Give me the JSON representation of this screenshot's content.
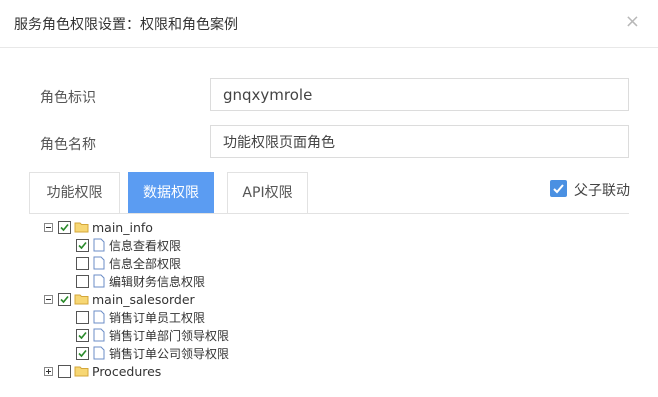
{
  "dialog": {
    "title": "服务角色权限设置：权限和角色案例",
    "close_glyph": "×"
  },
  "form": {
    "role_id_label": "角色标识",
    "role_id_value": "gnqxymrole",
    "role_name_label": "角色名称",
    "role_name_value": "功能权限页面角色"
  },
  "tabs": [
    {
      "label": "功能权限",
      "active": false
    },
    {
      "label": "数据权限",
      "active": true
    },
    {
      "label": "API权限",
      "active": false
    }
  ],
  "cascade": {
    "label": "父子联动",
    "checked": true
  },
  "tree": {
    "nodes": [
      {
        "label": "main_info",
        "type": "folder",
        "checked": true,
        "expanded": true
      },
      {
        "label": "信息查看权限",
        "type": "file",
        "checked": true
      },
      {
        "label": "信息全部权限",
        "type": "file",
        "checked": false
      },
      {
        "label": "编辑财务信息权限",
        "type": "file",
        "checked": false
      },
      {
        "label": "main_salesorder",
        "type": "folder",
        "checked": true,
        "expanded": true
      },
      {
        "label": "销售订单员工权限",
        "type": "file",
        "checked": false
      },
      {
        "label": "销售订单部门领导权限",
        "type": "file",
        "checked": true
      },
      {
        "label": "销售订单公司领导权限",
        "type": "file",
        "checked": true
      },
      {
        "label": "Procedures",
        "type": "folder",
        "checked": false,
        "expanded": false
      }
    ]
  },
  "colors": {
    "accent": "#5b9cf2",
    "checkbox": "#4a90e2",
    "folder": "#f7d774"
  }
}
